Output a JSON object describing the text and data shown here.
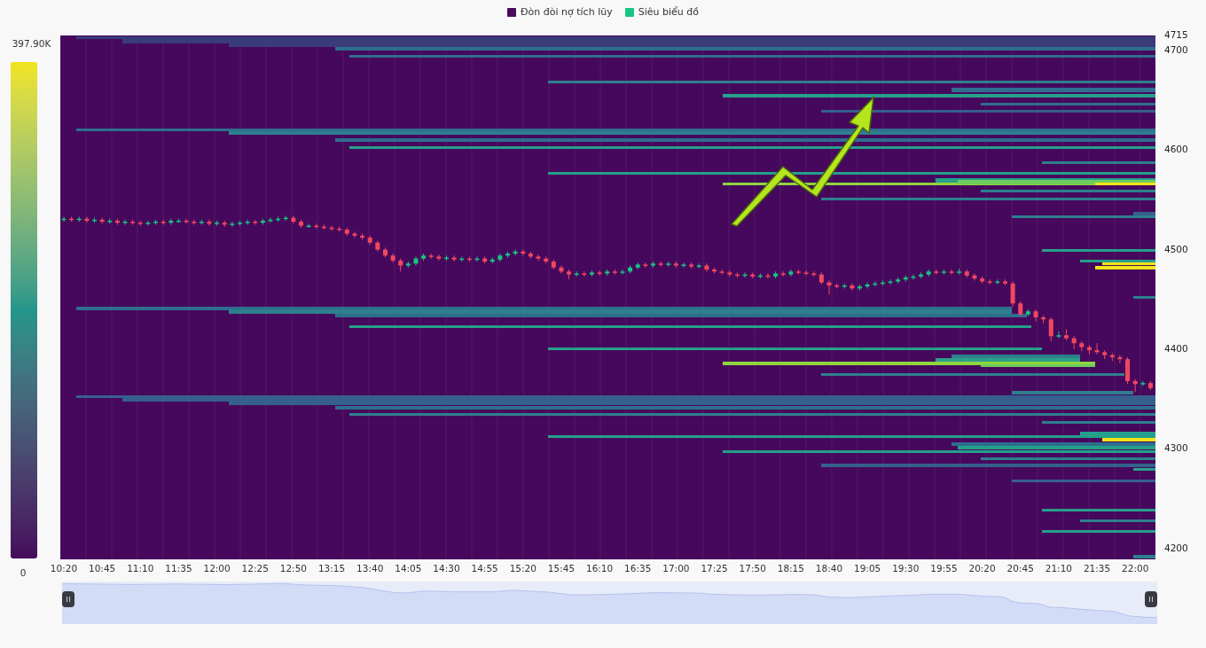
{
  "legend": [
    {
      "label": "Đòn đòi nợ tích lũy",
      "color": "#4a0a5c"
    },
    {
      "label": "Siêu biểu đồ",
      "color": "#16c784"
    }
  ],
  "color_scale": {
    "max_label": "397.90K",
    "min_label": "0"
  },
  "chart_data": {
    "type": "candlestick",
    "ylim": [
      4189,
      4715
    ],
    "yticks": [
      4715,
      4700,
      4600,
      4500,
      4400,
      4300,
      4200
    ],
    "categories": [
      "10:20",
      null,
      null,
      null,
      null,
      "10:45",
      null,
      null,
      null,
      null,
      "11:10",
      null,
      null,
      null,
      null,
      "11:35",
      null,
      null,
      null,
      null,
      "12:00",
      null,
      null,
      null,
      null,
      "12:25",
      null,
      null,
      null,
      null,
      "12:50",
      null,
      null,
      null,
      null,
      "13:15",
      null,
      null,
      null,
      null,
      "13:40",
      null,
      null,
      null,
      null,
      "14:05",
      null,
      null,
      null,
      null,
      "14:30",
      null,
      null,
      null,
      null,
      "14:55",
      null,
      null,
      null,
      null,
      "15:20",
      null,
      null,
      null,
      null,
      "15:45",
      null,
      null,
      null,
      null,
      "16:10",
      null,
      null,
      null,
      null,
      "16:35",
      null,
      null,
      null,
      null,
      "17:00",
      null,
      null,
      null,
      null,
      "17:25",
      null,
      null,
      null,
      null,
      "17:50",
      null,
      null,
      null,
      null,
      "18:15",
      null,
      null,
      null,
      null,
      "18:40",
      null,
      null,
      null,
      null,
      "19:05",
      null,
      null,
      null,
      null,
      "19:30",
      null,
      null,
      null,
      null,
      "19:55",
      null,
      null,
      null,
      null,
      "20:20",
      null,
      null,
      null,
      null,
      "20:45",
      null,
      null,
      null,
      null,
      "21:10",
      null,
      null,
      null,
      null,
      "21:35",
      null,
      null,
      null,
      null,
      "22:00",
      null,
      null
    ],
    "ohlc": [
      [
        4530,
        4533,
        4528,
        4531
      ],
      [
        4531,
        4533,
        4528,
        4530
      ],
      [
        4530,
        4533,
        4528,
        4531
      ],
      [
        4531,
        4533,
        4527,
        4529
      ],
      [
        4529,
        4532,
        4527,
        4530
      ],
      [
        4530,
        4532,
        4526,
        4528
      ],
      [
        4528,
        4531,
        4526,
        4529
      ],
      [
        4529,
        4531,
        4525,
        4527
      ],
      [
        4527,
        4530,
        4525,
        4528
      ],
      [
        4528,
        4530,
        4525,
        4527
      ],
      [
        4527,
        4529,
        4524,
        4526
      ],
      [
        4526,
        4529,
        4524,
        4527
      ],
      [
        4527,
        4530,
        4525,
        4528
      ],
      [
        4528,
        4530,
        4525,
        4527
      ],
      [
        4527,
        4531,
        4525,
        4529
      ],
      [
        4529,
        4531,
        4527,
        4529
      ],
      [
        4529,
        4531,
        4526,
        4528
      ],
      [
        4528,
        4530,
        4525,
        4527
      ],
      [
        4527,
        4530,
        4525,
        4528
      ],
      [
        4528,
        4530,
        4524,
        4526
      ],
      [
        4526,
        4529,
        4524,
        4527
      ],
      [
        4527,
        4529,
        4523,
        4525
      ],
      [
        4525,
        4528,
        4523,
        4526
      ],
      [
        4526,
        4529,
        4524,
        4527
      ],
      [
        4527,
        4530,
        4525,
        4528
      ],
      [
        4528,
        4530,
        4525,
        4527
      ],
      [
        4527,
        4531,
        4525,
        4529
      ],
      [
        4529,
        4532,
        4527,
        4530
      ],
      [
        4530,
        4533,
        4528,
        4531
      ],
      [
        4531,
        4534,
        4529,
        4532
      ],
      [
        4532,
        4534,
        4526,
        4528
      ],
      [
        4528,
        4530,
        4522,
        4524
      ],
      [
        4524,
        4526,
        4522,
        4524
      ],
      [
        4524,
        4526,
        4521,
        4523
      ],
      [
        4523,
        4525,
        4520,
        4522
      ],
      [
        4522,
        4524,
        4519,
        4521
      ],
      [
        4521,
        4523,
        4518,
        4520
      ],
      [
        4520,
        4522,
        4514,
        4516
      ],
      [
        4516,
        4518,
        4512,
        4514
      ],
      [
        4514,
        4516,
        4510,
        4512
      ],
      [
        4512,
        4514,
        4505,
        4507
      ],
      [
        4507,
        4509,
        4498,
        4500
      ],
      [
        4500,
        4502,
        4492,
        4494
      ],
      [
        4494,
        4496,
        4487,
        4489
      ],
      [
        4489,
        4491,
        4478,
        4484
      ],
      [
        4484,
        4488,
        4482,
        4486
      ],
      [
        4486,
        4493,
        4484,
        4491
      ],
      [
        4491,
        4496,
        4489,
        4494
      ],
      [
        4494,
        4496,
        4491,
        4493
      ],
      [
        4493,
        4495,
        4489,
        4491
      ],
      [
        4491,
        4494,
        4489,
        4492
      ],
      [
        4492,
        4494,
        4488,
        4490
      ],
      [
        4490,
        4493,
        4488,
        4491
      ],
      [
        4491,
        4493,
        4488,
        4490
      ],
      [
        4490,
        4493,
        4488,
        4491
      ],
      [
        4491,
        4493,
        4486,
        4488
      ],
      [
        4488,
        4492,
        4486,
        4490
      ],
      [
        4490,
        4496,
        4488,
        4494
      ],
      [
        4494,
        4498,
        4492,
        4496
      ],
      [
        4496,
        4500,
        4494,
        4498
      ],
      [
        4498,
        4500,
        4494,
        4496
      ],
      [
        4496,
        4498,
        4491,
        4493
      ],
      [
        4493,
        4495,
        4489,
        4491
      ],
      [
        4491,
        4493,
        4486,
        4488
      ],
      [
        4488,
        4490,
        4480,
        4482
      ],
      [
        4482,
        4484,
        4476,
        4478
      ],
      [
        4478,
        4480,
        4470,
        4475
      ],
      [
        4475,
        4478,
        4473,
        4476
      ],
      [
        4476,
        4478,
        4473,
        4475
      ],
      [
        4475,
        4479,
        4473,
        4477
      ],
      [
        4477,
        4479,
        4474,
        4476
      ],
      [
        4476,
        4480,
        4474,
        4478
      ],
      [
        4478,
        4480,
        4475,
        4477
      ],
      [
        4477,
        4480,
        4475,
        4478
      ],
      [
        4478,
        4484,
        4476,
        4482
      ],
      [
        4482,
        4487,
        4480,
        4485
      ],
      [
        4485,
        4487,
        4482,
        4484
      ],
      [
        4484,
        4488,
        4482,
        4486
      ],
      [
        4486,
        4488,
        4483,
        4485
      ],
      [
        4485,
        4488,
        4483,
        4486
      ],
      [
        4486,
        4488,
        4482,
        4484
      ],
      [
        4484,
        4487,
        4482,
        4485
      ],
      [
        4485,
        4487,
        4481,
        4483
      ],
      [
        4483,
        4486,
        4481,
        4484
      ],
      [
        4484,
        4486,
        4478,
        4480
      ],
      [
        4480,
        4482,
        4476,
        4478
      ],
      [
        4478,
        4480,
        4475,
        4477
      ],
      [
        4477,
        4479,
        4473,
        4475
      ],
      [
        4475,
        4477,
        4472,
        4474
      ],
      [
        4474,
        4477,
        4472,
        4475
      ],
      [
        4475,
        4477,
        4471,
        4473
      ],
      [
        4473,
        4476,
        4471,
        4474
      ],
      [
        4474,
        4476,
        4471,
        4473
      ],
      [
        4473,
        4478,
        4471,
        4476
      ],
      [
        4476,
        4478,
        4473,
        4475
      ],
      [
        4475,
        4480,
        4473,
        4478
      ],
      [
        4478,
        4480,
        4475,
        4477
      ],
      [
        4477,
        4479,
        4474,
        4476
      ],
      [
        4476,
        4478,
        4473,
        4475
      ],
      [
        4475,
        4477,
        4465,
        4467
      ],
      [
        4467,
        4469,
        4455,
        4464
      ],
      [
        4464,
        4466,
        4461,
        4463
      ],
      [
        4463,
        4466,
        4461,
        4464
      ],
      [
        4464,
        4466,
        4459,
        4461
      ],
      [
        4461,
        4465,
        4459,
        4463
      ],
      [
        4463,
        4467,
        4461,
        4465
      ],
      [
        4465,
        4468,
        4463,
        4466
      ],
      [
        4466,
        4469,
        4464,
        4467
      ],
      [
        4467,
        4470,
        4465,
        4468
      ],
      [
        4468,
        4472,
        4466,
        4470
      ],
      [
        4470,
        4474,
        4468,
        4472
      ],
      [
        4472,
        4475,
        4470,
        4473
      ],
      [
        4473,
        4477,
        4471,
        4475
      ],
      [
        4475,
        4480,
        4473,
        4478
      ],
      [
        4478,
        4480,
        4475,
        4477
      ],
      [
        4477,
        4480,
        4475,
        4478
      ],
      [
        4478,
        4480,
        4475,
        4477
      ],
      [
        4477,
        4481,
        4475,
        4478
      ],
      [
        4478,
        4480,
        4472,
        4474
      ],
      [
        4474,
        4476,
        4469,
        4471
      ],
      [
        4471,
        4473,
        4466,
        4468
      ],
      [
        4468,
        4470,
        4465,
        4467
      ],
      [
        4467,
        4470,
        4465,
        4468
      ],
      [
        4468,
        4470,
        4464,
        4466
      ],
      [
        4466,
        4468,
        4443,
        4446
      ],
      [
        4446,
        4448,
        4433,
        4435
      ],
      [
        4435,
        4440,
        4433,
        4438
      ],
      [
        4438,
        4440,
        4428,
        4432
      ],
      [
        4432,
        4434,
        4426,
        4430
      ],
      [
        4430,
        4432,
        4408,
        4413
      ],
      [
        4413,
        4418,
        4411,
        4414
      ],
      [
        4414,
        4420,
        4409,
        4411
      ],
      [
        4411,
        4413,
        4400,
        4406
      ],
      [
        4406,
        4408,
        4398,
        4402
      ],
      [
        4402,
        4404,
        4395,
        4399
      ],
      [
        4399,
        4406,
        4395,
        4397
      ],
      [
        4397,
        4399,
        4390,
        4394
      ],
      [
        4394,
        4396,
        4388,
        4392
      ],
      [
        4392,
        4394,
        4386,
        4390
      ],
      [
        4390,
        4392,
        4365,
        4368
      ],
      [
        4368,
        4370,
        4357,
        4365
      ],
      [
        4365,
        4368,
        4363,
        4366
      ],
      [
        4366,
        4368,
        4359,
        4361
      ]
    ]
  }
}
